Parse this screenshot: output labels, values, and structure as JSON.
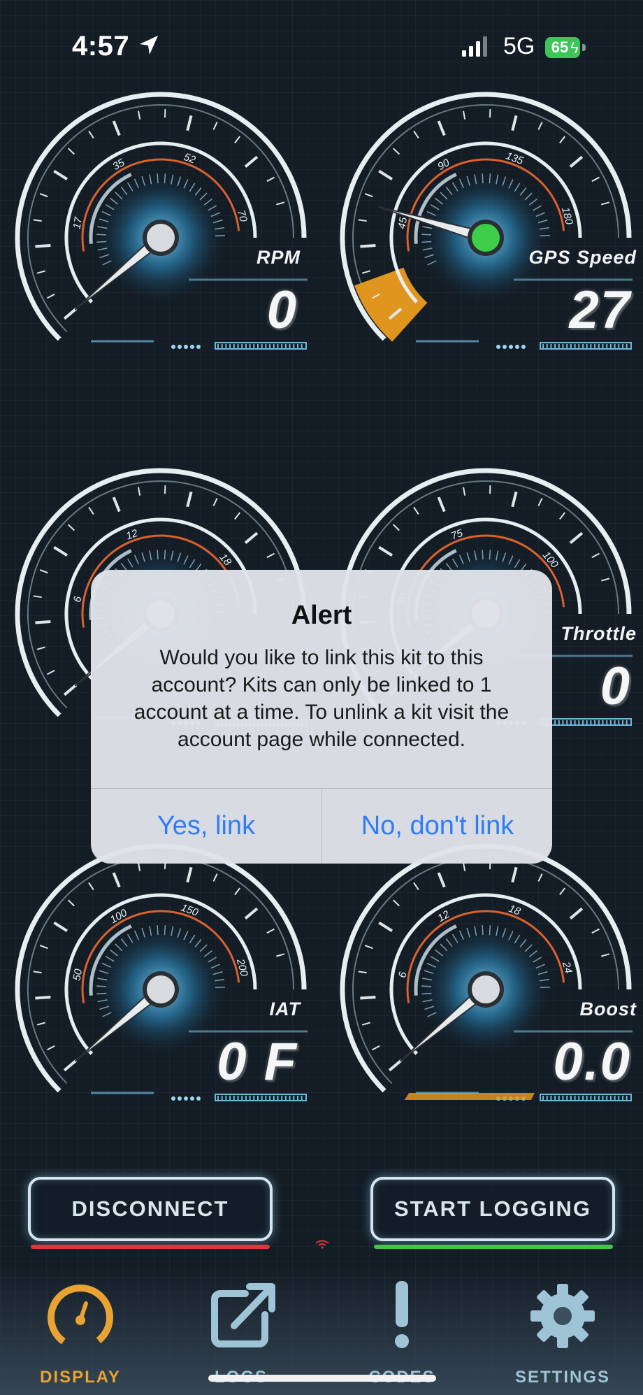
{
  "status_bar": {
    "time": "4:57",
    "network": "5G",
    "battery": "65",
    "icons": [
      "location-arrow-icon",
      "cellular-signal-icon",
      "battery-charging-icon"
    ]
  },
  "gauges": [
    {
      "id": "rpm",
      "label": "RPM",
      "value": "0",
      "ticks": [
        "17",
        "35",
        "52",
        "70"
      ],
      "hub_color": "#d9dcdf"
    },
    {
      "id": "gps-speed",
      "label": "GPS Speed",
      "value": "27",
      "ticks": [
        "45",
        "90",
        "135",
        "180"
      ],
      "hub_color": "#3ecf48",
      "warning_fill": "#e0961e"
    },
    {
      "id": "gauge-3",
      "label": "",
      "value": "",
      "ticks": [
        "6",
        "12",
        "18"
      ],
      "hub_color": "#d9dcdf"
    },
    {
      "id": "throttle",
      "label": "Throttle",
      "value": "0",
      "ticks": [
        "50",
        "75",
        "100"
      ],
      "hub_color": "#d9dcdf"
    },
    {
      "id": "iat",
      "label": "IAT",
      "value": "0 F",
      "ticks": [
        "50",
        "100",
        "150",
        "200"
      ],
      "hub_color": "#d9dcdf"
    },
    {
      "id": "boost",
      "label": "Boost",
      "value": "0.0",
      "ticks": [
        "6",
        "12",
        "18",
        "24"
      ],
      "hub_color": "#d9dcdf"
    }
  ],
  "alert": {
    "title": "Alert",
    "message": "Would you like to link this kit to this account?  Kits can only be linked to 1 account at a time.  To unlink a kit visit the account page while connected.",
    "confirm_label": "Yes, link",
    "cancel_label": "No, don't link"
  },
  "actions": {
    "disconnect_label": "DISCONNECT",
    "start_logging_label": "START LOGGING"
  },
  "tabs": [
    {
      "label": "DISPLAY",
      "icon": "speedometer-icon",
      "active": true
    },
    {
      "label": "LOGS",
      "icon": "share-arrow-icon",
      "active": false
    },
    {
      "label": "CODES",
      "icon": "exclamation-icon",
      "active": false
    },
    {
      "label": "SETTINGS",
      "icon": "gear-icon",
      "active": false
    }
  ],
  "colors": {
    "accent_orange": "#e0961e",
    "alert_button_blue": "#2f7cf6",
    "disconnect_red": "#e0353a",
    "logging_green": "#46c34a",
    "gauge_glow": "#4fb6e6"
  }
}
